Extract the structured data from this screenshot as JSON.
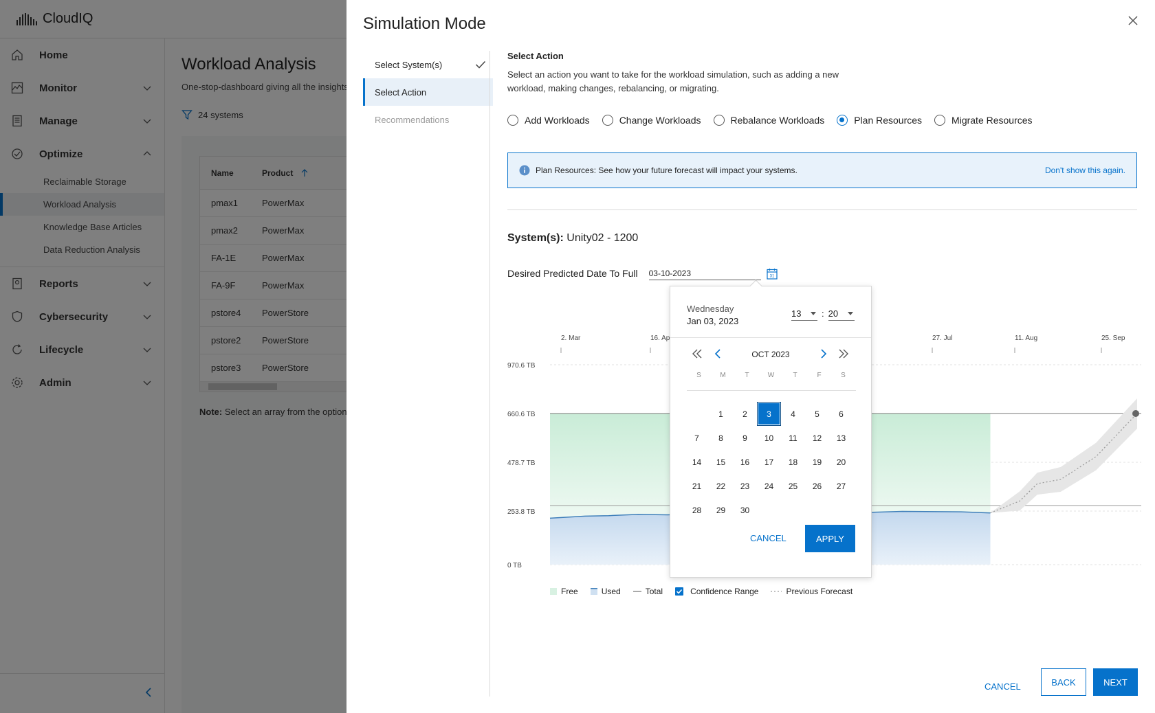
{
  "app": {
    "brand": "CloudIQ"
  },
  "sidebar": {
    "items": [
      {
        "label": "Home",
        "icon": "home-icon"
      },
      {
        "label": "Monitor",
        "icon": "monitor-icon"
      },
      {
        "label": "Manage",
        "icon": "manage-icon"
      },
      {
        "label": "Optimize",
        "icon": "optimize-icon"
      }
    ],
    "optimize_sub": [
      {
        "label": "Reclaimable Storage"
      },
      {
        "label": "Workload Analysis"
      },
      {
        "label": "Knowledge Base Articles"
      },
      {
        "label": "Data Reduction Analysis"
      }
    ],
    "items_after": [
      {
        "label": "Reports"
      },
      {
        "label": "Cybersecurity"
      },
      {
        "label": "Lifecycle"
      },
      {
        "label": "Admin"
      }
    ]
  },
  "page": {
    "title": "Workload Analysis",
    "subtitle": "One-stop-dashboard giving all the insights",
    "filter_label": "24 systems",
    "table": {
      "headers": [
        "Name",
        "Product"
      ],
      "rows": [
        [
          "pmax1",
          "PowerMax"
        ],
        [
          "pmax2",
          "PowerMax"
        ],
        [
          "FA-1E",
          "PowerMax"
        ],
        [
          "FA-9F",
          "PowerMax"
        ],
        [
          "pstore4",
          "PowerStore"
        ],
        [
          "pstore2",
          "PowerStore"
        ],
        [
          "pstore3",
          "PowerStore"
        ]
      ]
    },
    "note_bold": "Note:",
    "note_text": " Select an array from the option"
  },
  "drawer": {
    "title": "Simulation Mode",
    "steps": [
      {
        "label": "Select System(s)",
        "state": "done"
      },
      {
        "label": "Select Action",
        "state": "active"
      },
      {
        "label": "Recommendations",
        "state": "disabled"
      }
    ],
    "section_title": "Select Action",
    "section_desc": "Select an action you want to take for the workload simulation, such as adding a new workload, making changes, rebalancing, or migrating.",
    "actions": [
      {
        "label": "Add Workloads",
        "selected": false
      },
      {
        "label": "Change Workloads",
        "selected": false
      },
      {
        "label": "Rebalance Workloads",
        "selected": false
      },
      {
        "label": "Plan Resources",
        "selected": true
      },
      {
        "label": "Migrate Resources",
        "selected": false
      }
    ],
    "banner_text": "Plan Resources: See how your future forecast will impact your systems.",
    "banner_dismiss": "Don't show this again.",
    "systems_label": "System(s):",
    "systems_value": "Unity02 - 1200",
    "date_label": "Desired Predicted Date To Full",
    "date_value": "03-10-2023",
    "calendar_icon_text": "31",
    "buttons": {
      "cancel": "CANCEL",
      "back": "BACK",
      "next": "NEXT"
    }
  },
  "date_picker": {
    "day_of_week": "Wednesday",
    "date": "Jan 03, 2023",
    "hour": "13",
    "minute": "20",
    "month_label": "OCT 2023",
    "weekdays": [
      "S",
      "M",
      "T",
      "W",
      "T",
      "F",
      "S"
    ],
    "leading_blanks": 1,
    "days_in_month": 30,
    "selected_day": 3,
    "cancel": "CANCEL",
    "apply": "APPLY"
  },
  "chart_data": {
    "type": "area",
    "x_ticks": [
      "2. Mar",
      "16. Ap",
      "27. Jul",
      "11. Aug",
      "25. Sep"
    ],
    "y_ticks": [
      "970.6 TB",
      "660.6 TB",
      "478.7 TB",
      "253.8 TB",
      "0 TB"
    ],
    "y_tick_values": [
      970.6,
      660.6,
      478.7,
      253.8,
      0
    ],
    "legend": [
      "Free",
      "Used",
      "Total",
      "Confidence Range",
      "Previous Forecast"
    ],
    "legend_confidence_checked": true,
    "total_capacity_tb": 660.6,
    "used_series": {
      "name": "Used",
      "points": [
        [
          0,
          220
        ],
        [
          0.06,
          230
        ],
        [
          0.1,
          232
        ],
        [
          0.15,
          238
        ],
        [
          0.2,
          236
        ],
        [
          0.28,
          240
        ],
        [
          0.35,
          245
        ],
        [
          0.55,
          248
        ],
        [
          0.6,
          252
        ],
        [
          0.7,
          250
        ],
        [
          0.75,
          245
        ]
      ]
    },
    "forecast_series": {
      "name": "Previous Forecast",
      "points": [
        [
          0.75,
          245
        ],
        [
          0.8,
          300
        ],
        [
          0.83,
          380
        ],
        [
          0.87,
          400
        ],
        [
          0.93,
          500
        ],
        [
          1.0,
          660.6
        ]
      ]
    },
    "colors": {
      "free": "#d8f1e2",
      "used": "#cfe0f1",
      "used_line": "#3f7fba",
      "total": "#777777",
      "forecast": "#9b9b9b",
      "confidence": "#e6e6e6"
    }
  },
  "colors": {
    "accent": "#0672cb"
  }
}
